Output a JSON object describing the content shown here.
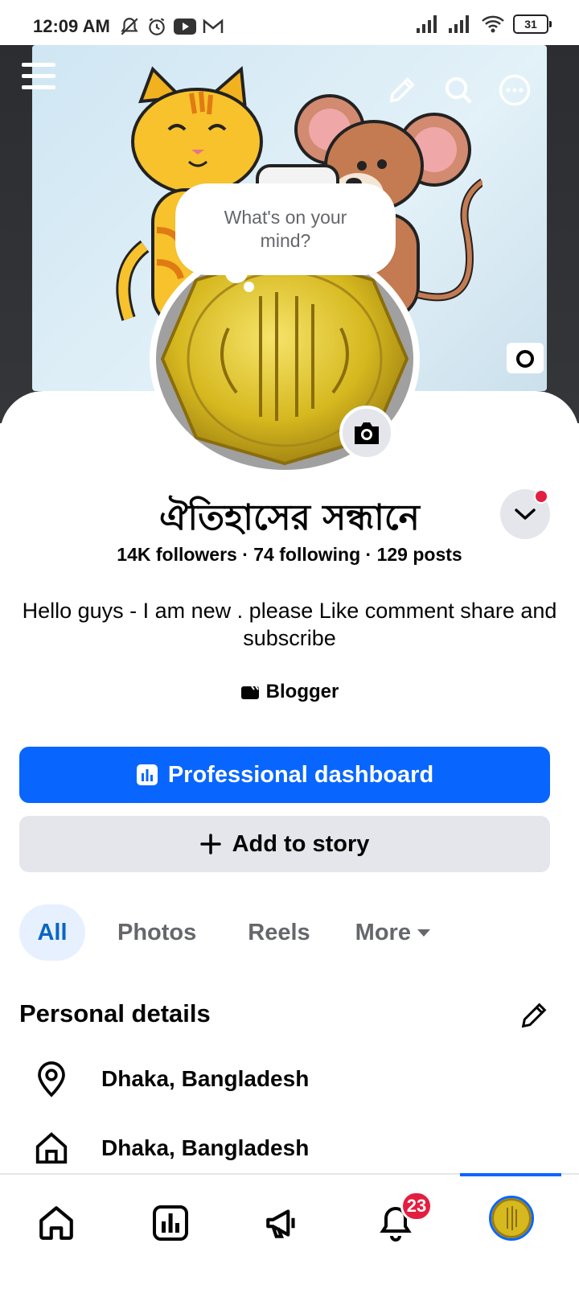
{
  "status_bar": {
    "time": "12:09 AM",
    "battery": "31"
  },
  "top_actions": [
    "menu-icon",
    "pencil-icon",
    "search-icon",
    "more-icon"
  ],
  "composer": {
    "prompt": "What's on your mind?"
  },
  "profile": {
    "name": "ঐতিহাসের সন্ধানে",
    "stats": "14K followers · 74 following · 129 posts",
    "bio": "Hello guys - I am new . please Like comment share and subscribe",
    "category": "Blogger"
  },
  "buttons": {
    "dashboard": "Professional dashboard",
    "add_story": "Add to story"
  },
  "tabs": [
    "All",
    "Photos",
    "Reels",
    "More"
  ],
  "personal_details": {
    "title": "Personal details",
    "items": [
      {
        "icon": "location-pin-icon",
        "text": "Dhaka, Bangladesh"
      },
      {
        "icon": "home-icon",
        "text": "Dhaka, Bangladesh"
      }
    ]
  },
  "bottom_nav": {
    "notifications_count": "23"
  },
  "colors": {
    "primary": "#0866ff",
    "badge": "#e41e3f",
    "secondary_bg": "#e4e6eb"
  }
}
